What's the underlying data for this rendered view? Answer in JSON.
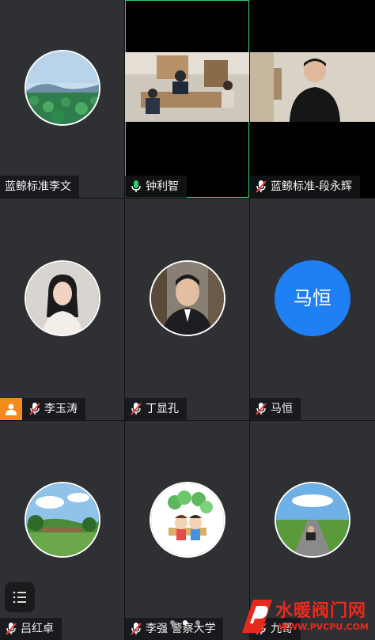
{
  "participants": [
    {
      "name": "蓝鲸标准李文",
      "mic": false,
      "video": false,
      "avatar": "landscape-lotus"
    },
    {
      "name": "钟利智",
      "mic": true,
      "mic_active": true,
      "video": true,
      "active_speaker": true
    },
    {
      "name": "蓝鲸标准-段永辉",
      "mic": true,
      "muted": true,
      "video": true
    },
    {
      "name": "李玉涛",
      "mic": true,
      "muted": true,
      "host_badge": true,
      "avatar": "woman-portrait"
    },
    {
      "name": "丁显孔",
      "mic": true,
      "muted": true,
      "avatar": "man-portrait"
    },
    {
      "name": "马恒",
      "mic": true,
      "muted": true,
      "avatar_text": "马恒"
    },
    {
      "name": "吕红卓",
      "mic": true,
      "muted": true,
      "avatar": "landscape-field"
    },
    {
      "name": "李强 警察大学",
      "mic": true,
      "muted": true,
      "avatar": "cartoon-clover"
    },
    {
      "name": "九哥",
      "mic": true,
      "muted": true,
      "avatar": "road-landscape"
    }
  ],
  "pager": {
    "pages": 3,
    "current": 2
  },
  "watermark": {
    "text": "水暖阀门网",
    "url": "WWW.PVCPU.COM"
  },
  "colors": {
    "active_border": "#2ecc71",
    "muted_mic": "#e8413b",
    "avatar_blue": "#1f7ff5",
    "host_badge": "#f28a1c"
  }
}
